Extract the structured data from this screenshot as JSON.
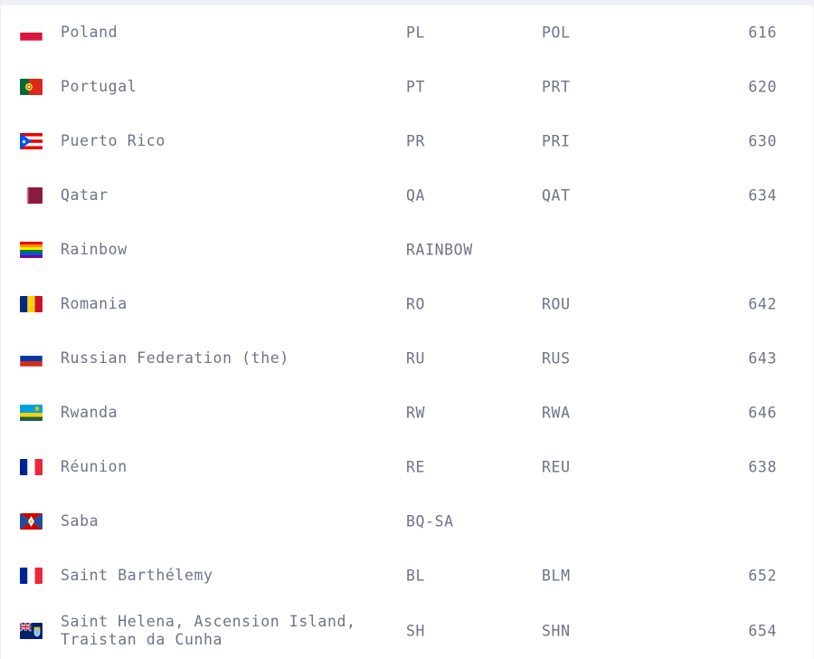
{
  "rows": [
    {
      "name": "Poland",
      "alpha2": "PL",
      "alpha3": "POL",
      "numeric": "616",
      "flag": "flag-poland-icon"
    },
    {
      "name": "Portugal",
      "alpha2": "PT",
      "alpha3": "PRT",
      "numeric": "620",
      "flag": "flag-portugal-icon"
    },
    {
      "name": "Puerto Rico",
      "alpha2": "PR",
      "alpha3": "PRI",
      "numeric": "630",
      "flag": "flag-puerto-rico-icon"
    },
    {
      "name": "Qatar",
      "alpha2": "QA",
      "alpha3": "QAT",
      "numeric": "634",
      "flag": "flag-qatar-icon"
    },
    {
      "name": "Rainbow",
      "alpha2": "RAINBOW",
      "alpha3": "",
      "numeric": "",
      "flag": "flag-rainbow-icon"
    },
    {
      "name": "Romania",
      "alpha2": "RO",
      "alpha3": "ROU",
      "numeric": "642",
      "flag": "flag-romania-icon"
    },
    {
      "name": "Russian Federation (the)",
      "alpha2": "RU",
      "alpha3": "RUS",
      "numeric": "643",
      "flag": "flag-russia-icon"
    },
    {
      "name": "Rwanda",
      "alpha2": "RW",
      "alpha3": "RWA",
      "numeric": "646",
      "flag": "flag-rwanda-icon"
    },
    {
      "name": "Réunion",
      "alpha2": "RE",
      "alpha3": "REU",
      "numeric": "638",
      "flag": "flag-reunion-icon"
    },
    {
      "name": "Saba",
      "alpha2": "BQ-SA",
      "alpha3": "",
      "numeric": "",
      "flag": "flag-saba-icon"
    },
    {
      "name": "Saint Barthélemy",
      "alpha2": "BL",
      "alpha3": "BLM",
      "numeric": "652",
      "flag": "flag-saint-barthelemy-icon"
    },
    {
      "name": "Saint Helena, Ascension Island, Traistan da Cunha",
      "alpha2": "SH",
      "alpha3": "SHN",
      "numeric": "654",
      "flag": "flag-saint-helena-icon"
    }
  ],
  "colors": {
    "text": "#6f7388",
    "row_background": "#ffffff",
    "page_background": "#f7f8fb"
  }
}
